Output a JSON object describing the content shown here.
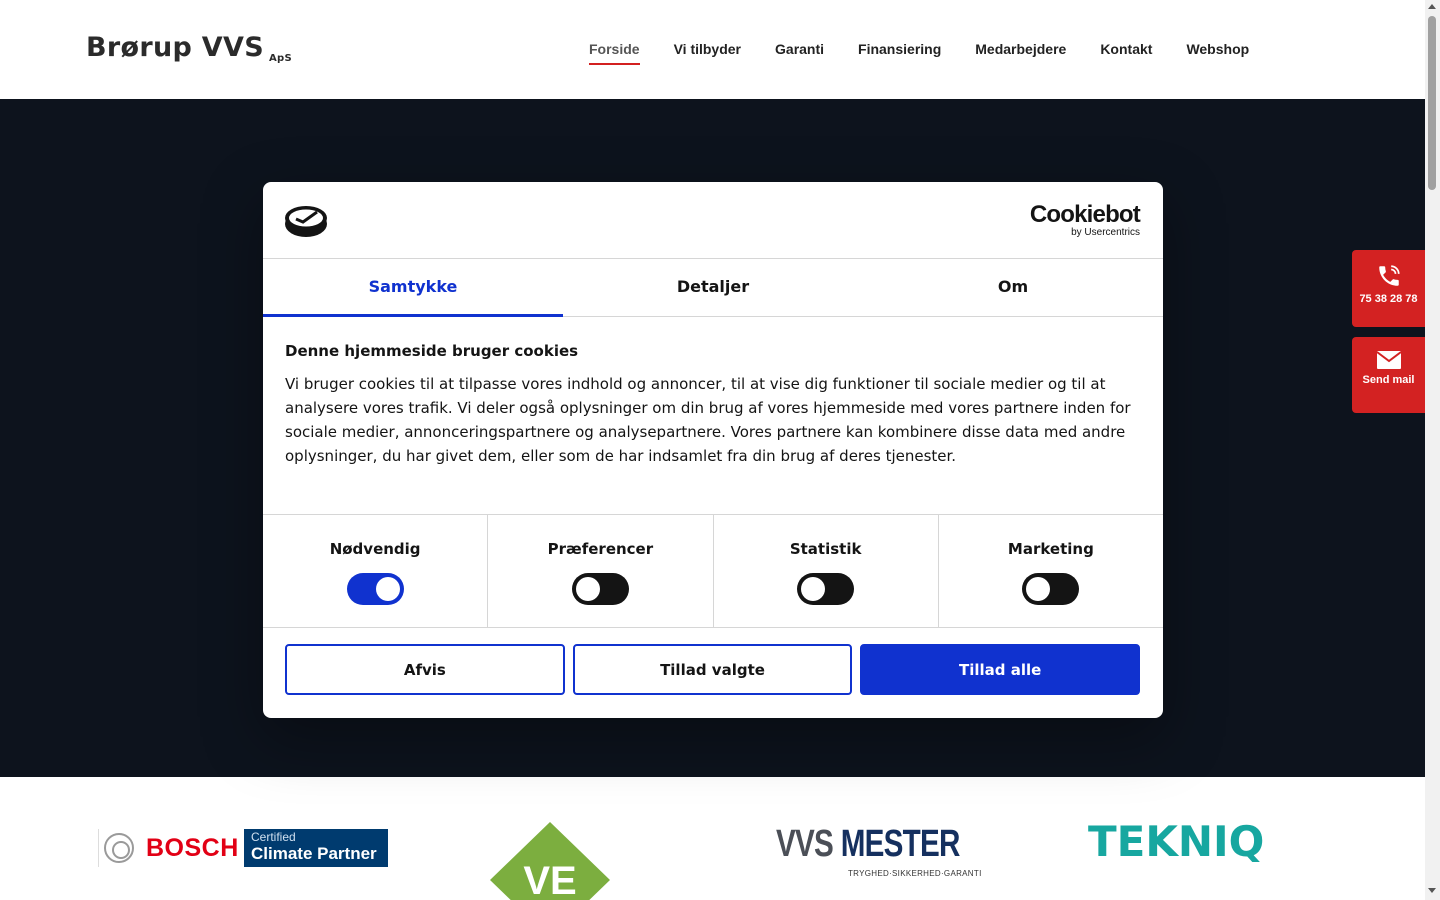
{
  "header": {
    "logo": "Brørup VVS",
    "logo_suffix": "ApS",
    "nav": [
      "Forside",
      "Vi tilbyder",
      "Garanti",
      "Finansiering",
      "Medarbejdere",
      "Kontakt",
      "Webshop"
    ],
    "active_nav": "Forside"
  },
  "side": {
    "phone": "75 38 28 78",
    "mail": "Send mail",
    "accent": "#d32222"
  },
  "cookie": {
    "brand": "Cookiebot",
    "brand_by": "by Usercentrics",
    "tabs": [
      "Samtykke",
      "Detaljer",
      "Om"
    ],
    "active_tab": "Samtykke",
    "title": "Denne hjemmeside bruger cookies",
    "text": "Vi bruger cookies til at tilpasse vores indhold og annoncer, til at vise dig funktioner til sociale medier og til at analysere vores trafik. Vi deler også oplysninger om din brug af vores hjemmeside med vores partnere inden for sociale medier, annonceringspartnere og analysepartnere. Vores partnere kan kombinere disse data med andre oplysninger, du har givet dem, eller som de har indsamlet fra din brug af deres tjenester.",
    "toggles": [
      {
        "label": "Nødvendig",
        "on": true
      },
      {
        "label": "Præferencer",
        "on": false
      },
      {
        "label": "Statistik",
        "on": false
      },
      {
        "label": "Marketing",
        "on": false
      }
    ],
    "buttons": {
      "reject": "Afvis",
      "allow_selected": "Tillad valgte",
      "allow_all": "Tillad alle"
    },
    "accent": "#1032cf"
  },
  "partners": {
    "bosch": "BOSCH",
    "bosch_badge_1": "Certified",
    "bosch_badge_2": "Climate Partner",
    "ve": "VE",
    "vvs_1": "VVS",
    "vvs_2": "MESTER",
    "vvs_tag": "TRYGHED·SIKKERHED·GARANTI",
    "tekniq": "TEKNIQ"
  }
}
